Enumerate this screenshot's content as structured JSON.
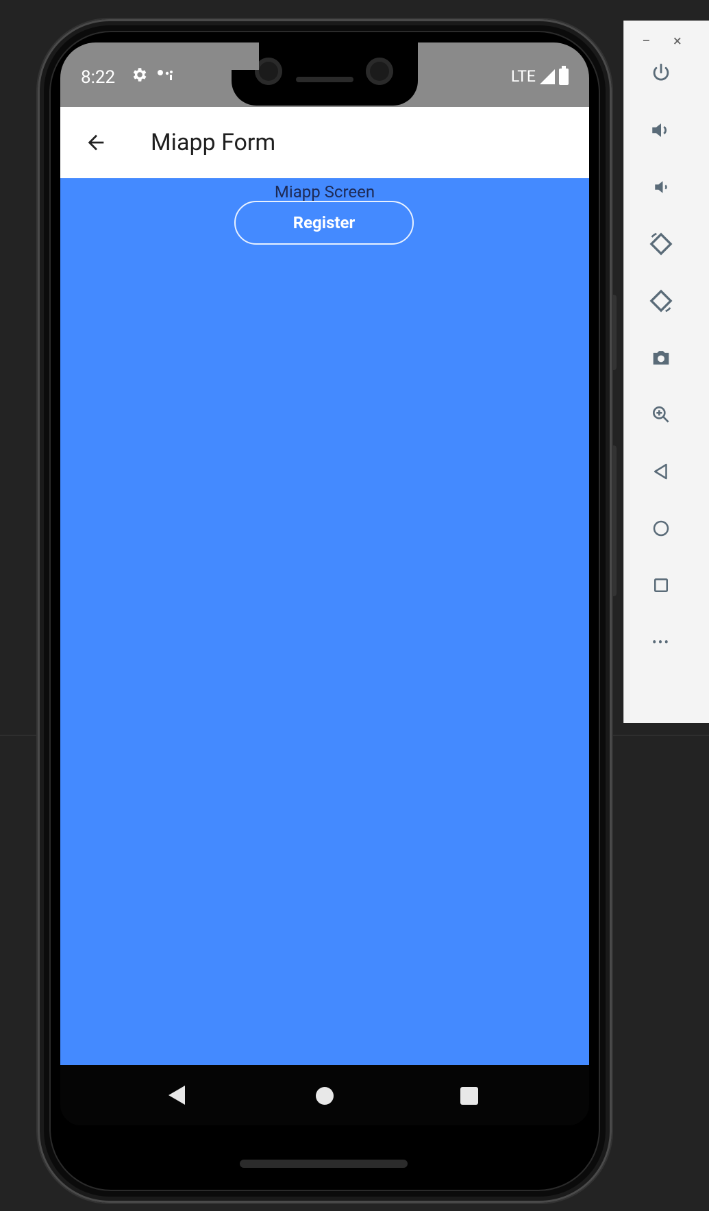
{
  "statusbar": {
    "time": "8:22",
    "network": "LTE"
  },
  "appbar": {
    "title": "Miapp Form"
  },
  "content": {
    "screen_label": "Miapp Screen",
    "register_label": "Register",
    "background_color": "#448aff"
  },
  "emulator_panel": {
    "minimize_label": "−",
    "close_label": "×",
    "more_label": "•••",
    "buttons": [
      "power-icon",
      "volume-up-icon",
      "volume-down-icon",
      "rotate-left-icon",
      "rotate-right-icon",
      "camera-icon",
      "zoom-icon",
      "back-icon",
      "home-icon",
      "overview-icon",
      "more-icon"
    ]
  }
}
